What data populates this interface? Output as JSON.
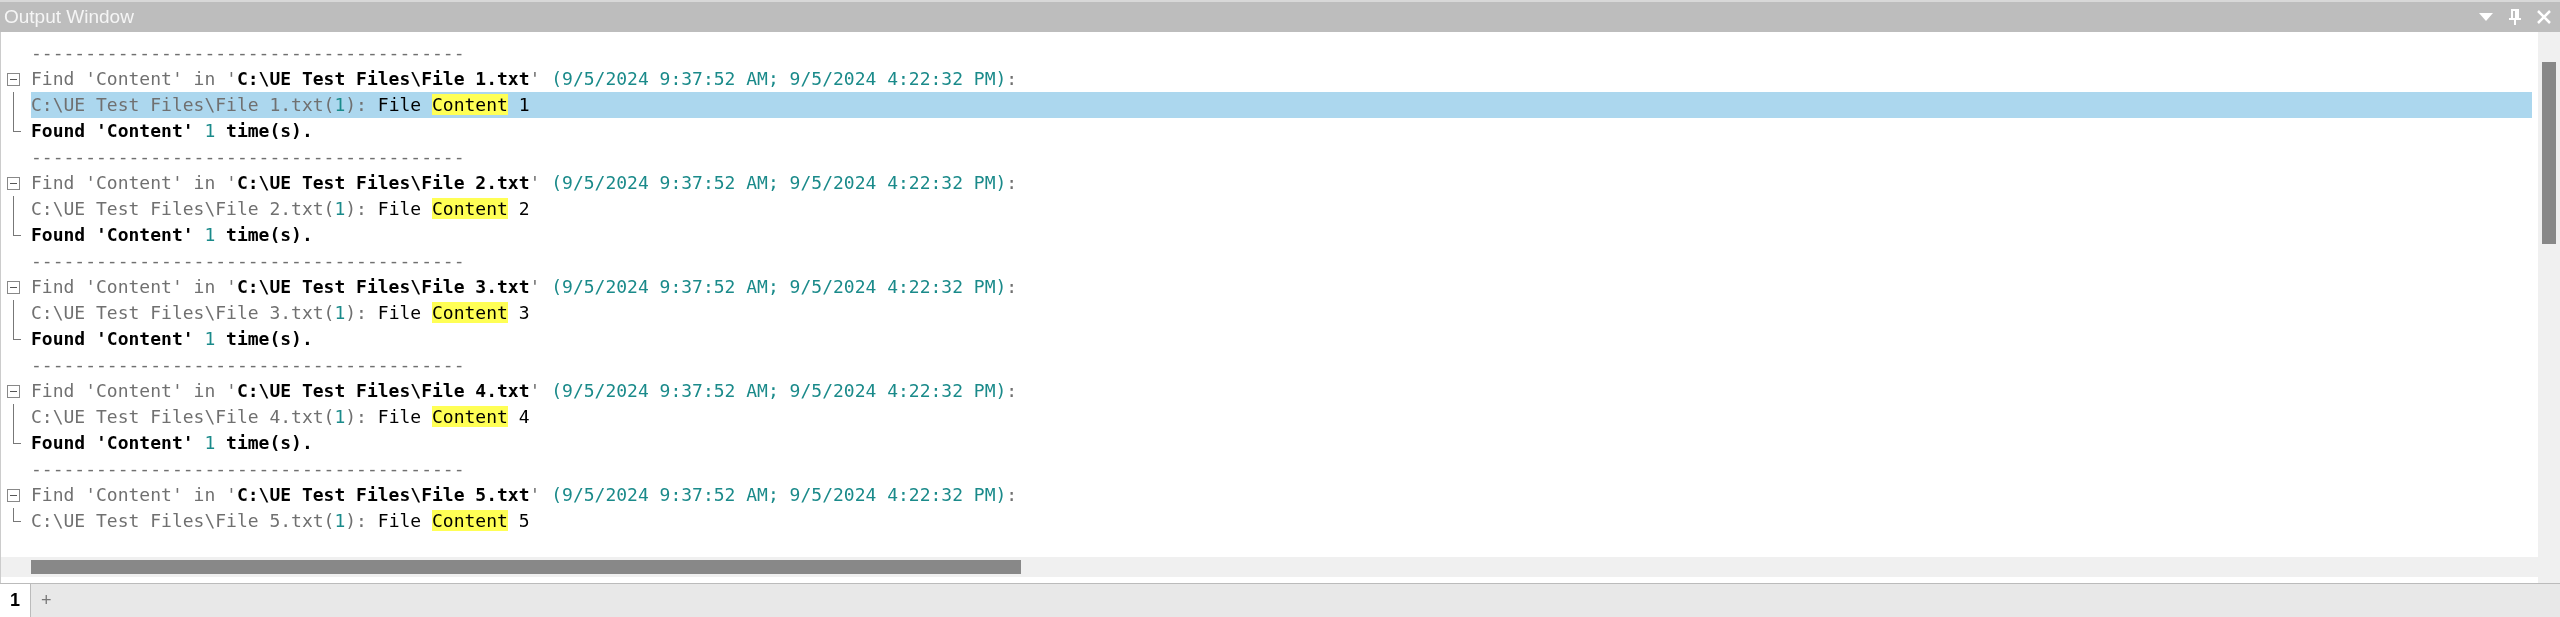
{
  "window": {
    "title": "Output Window"
  },
  "groups": [
    {
      "separator": "----------------------------------------",
      "expanded": true,
      "header": [
        {
          "kind": "plain",
          "text": "Find 'Content' in '"
        },
        {
          "kind": "bold",
          "text": "C:\\UE Test Files\\File 1.txt"
        },
        {
          "kind": "plain",
          "text": "' "
        },
        {
          "kind": "number",
          "text": "(9/5/2024 9:37:52 AM; 9/5/2024 4:22:32 PM)"
        },
        {
          "kind": "plain",
          "text": ":"
        }
      ],
      "results": [
        {
          "selected": true,
          "segments": [
            {
              "kind": "plain",
              "text": "C:\\UE Test Files\\File 1.txt("
            },
            {
              "kind": "number",
              "text": "1"
            },
            {
              "kind": "plain",
              "text": "): "
            },
            {
              "kind": "text",
              "text": "File "
            },
            {
              "kind": "match",
              "text": "Content"
            },
            {
              "kind": "text",
              "text": " 1"
            }
          ]
        }
      ],
      "summary": [
        {
          "kind": "bold",
          "text": "Found 'Content' "
        },
        {
          "kind": "number",
          "text": "1"
        },
        {
          "kind": "bold",
          "text": " time(s)."
        }
      ]
    },
    {
      "separator": "----------------------------------------",
      "expanded": true,
      "header": [
        {
          "kind": "plain",
          "text": "Find 'Content' in '"
        },
        {
          "kind": "bold",
          "text": "C:\\UE Test Files\\File 2.txt"
        },
        {
          "kind": "plain",
          "text": "' "
        },
        {
          "kind": "number",
          "text": "(9/5/2024 9:37:52 AM; 9/5/2024 4:22:32 PM)"
        },
        {
          "kind": "plain",
          "text": ":"
        }
      ],
      "results": [
        {
          "selected": false,
          "segments": [
            {
              "kind": "plain",
              "text": "C:\\UE Test Files\\File 2.txt("
            },
            {
              "kind": "number",
              "text": "1"
            },
            {
              "kind": "plain",
              "text": "): "
            },
            {
              "kind": "text",
              "text": "File "
            },
            {
              "kind": "match",
              "text": "Content"
            },
            {
              "kind": "text",
              "text": " 2"
            }
          ]
        }
      ],
      "summary": [
        {
          "kind": "bold",
          "text": "Found 'Content' "
        },
        {
          "kind": "number",
          "text": "1"
        },
        {
          "kind": "bold",
          "text": " time(s)."
        }
      ]
    },
    {
      "separator": "----------------------------------------",
      "expanded": true,
      "header": [
        {
          "kind": "plain",
          "text": "Find 'Content' in '"
        },
        {
          "kind": "bold",
          "text": "C:\\UE Test Files\\File 3.txt"
        },
        {
          "kind": "plain",
          "text": "' "
        },
        {
          "kind": "number",
          "text": "(9/5/2024 9:37:52 AM; 9/5/2024 4:22:32 PM)"
        },
        {
          "kind": "plain",
          "text": ":"
        }
      ],
      "results": [
        {
          "selected": false,
          "segments": [
            {
              "kind": "plain",
              "text": "C:\\UE Test Files\\File 3.txt("
            },
            {
              "kind": "number",
              "text": "1"
            },
            {
              "kind": "plain",
              "text": "): "
            },
            {
              "kind": "text",
              "text": "File "
            },
            {
              "kind": "match",
              "text": "Content"
            },
            {
              "kind": "text",
              "text": " 3"
            }
          ]
        }
      ],
      "summary": [
        {
          "kind": "bold",
          "text": "Found 'Content' "
        },
        {
          "kind": "number",
          "text": "1"
        },
        {
          "kind": "bold",
          "text": " time(s)."
        }
      ]
    },
    {
      "separator": "----------------------------------------",
      "expanded": true,
      "header": [
        {
          "kind": "plain",
          "text": "Find 'Content' in '"
        },
        {
          "kind": "bold",
          "text": "C:\\UE Test Files\\File 4.txt"
        },
        {
          "kind": "plain",
          "text": "' "
        },
        {
          "kind": "number",
          "text": "(9/5/2024 9:37:52 AM; 9/5/2024 4:22:32 PM)"
        },
        {
          "kind": "plain",
          "text": ":"
        }
      ],
      "results": [
        {
          "selected": false,
          "segments": [
            {
              "kind": "plain",
              "text": "C:\\UE Test Files\\File 4.txt("
            },
            {
              "kind": "number",
              "text": "1"
            },
            {
              "kind": "plain",
              "text": "): "
            },
            {
              "kind": "text",
              "text": "File "
            },
            {
              "kind": "match",
              "text": "Content"
            },
            {
              "kind": "text",
              "text": " 4"
            }
          ]
        }
      ],
      "summary": [
        {
          "kind": "bold",
          "text": "Found 'Content' "
        },
        {
          "kind": "number",
          "text": "1"
        },
        {
          "kind": "bold",
          "text": " time(s)."
        }
      ]
    },
    {
      "separator": "----------------------------------------",
      "expanded": true,
      "header": [
        {
          "kind": "plain",
          "text": "Find 'Content' in '"
        },
        {
          "kind": "bold",
          "text": "C:\\UE Test Files\\File 5.txt"
        },
        {
          "kind": "plain",
          "text": "' "
        },
        {
          "kind": "number",
          "text": "(9/5/2024 9:37:52 AM; 9/5/2024 4:22:32 PM)"
        },
        {
          "kind": "plain",
          "text": ":"
        }
      ],
      "results": [
        {
          "selected": false,
          "segments": [
            {
              "kind": "plain",
              "text": "C:\\UE Test Files\\File 5.txt("
            },
            {
              "kind": "number",
              "text": "1"
            },
            {
              "kind": "plain",
              "text": "): "
            },
            {
              "kind": "text",
              "text": "File "
            },
            {
              "kind": "match",
              "text": "Content"
            },
            {
              "kind": "text",
              "text": " 5"
            }
          ]
        }
      ]
    }
  ],
  "tabs": [
    {
      "label": "1",
      "selected": true
    },
    {
      "label": "+",
      "selected": false
    }
  ]
}
